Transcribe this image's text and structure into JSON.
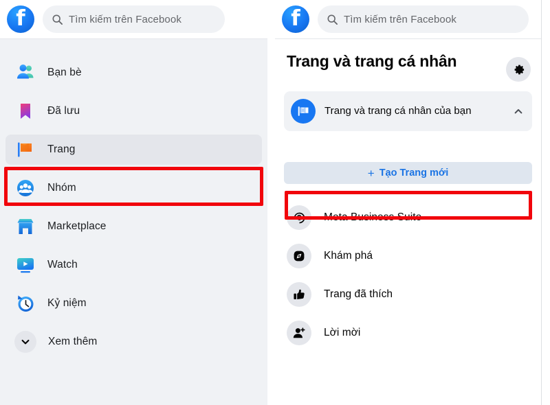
{
  "left": {
    "search": {
      "placeholder": "Tìm kiếm trên Facebook",
      "icon": "search-icon",
      "value": ""
    },
    "logo_icon": "facebook-logo-icon",
    "nav_items": [
      {
        "label": "Bạn bè",
        "icon": "friends-icon",
        "active": false
      },
      {
        "label": "Đã lưu",
        "icon": "bookmark-icon",
        "active": false
      },
      {
        "label": "Trang",
        "icon": "pages-flag-icon",
        "active": true
      },
      {
        "label": "Nhóm",
        "icon": "groups-icon",
        "active": false
      },
      {
        "label": "Marketplace",
        "icon": "marketplace-icon",
        "active": false
      },
      {
        "label": "Watch",
        "icon": "watch-icon",
        "active": false
      },
      {
        "label": "Kỷ niệm",
        "icon": "memories-icon",
        "active": false
      },
      {
        "label": "Xem thêm",
        "icon": "chevron-down-icon",
        "active": false
      }
    ]
  },
  "right": {
    "search": {
      "placeholder": "Tìm kiếm trên Facebook",
      "icon": "search-icon",
      "value": ""
    },
    "logo_icon": "facebook-logo-icon",
    "panel_title": "Trang và trang cá nhân",
    "settings_icon": "gear-icon",
    "your_pages": {
      "label": "Trang và trang cá nhân của bạn",
      "icon": "page-flag-icon",
      "expand_icon": "chevron-up-icon",
      "expanded": true
    },
    "create_button": {
      "label": "Tạo Trang mới",
      "plus": "+"
    },
    "menu_items": [
      {
        "label": "Meta Business Suite",
        "icon": "meta-icon"
      },
      {
        "label": "Khám phá",
        "icon": "compass-icon"
      },
      {
        "label": "Trang đã thích",
        "icon": "thumbs-up-icon"
      },
      {
        "label": "Lời mời",
        "icon": "person-add-icon"
      }
    ]
  },
  "annotations": {
    "highlight_color": "#f1050c",
    "boxes": [
      {
        "name": "trang-sidebar-highlight"
      },
      {
        "name": "tao-trang-moi-highlight"
      }
    ]
  },
  "colors": {
    "brand_blue": "#1877f2",
    "link_blue": "#1b74e4",
    "sidebar_bg": "#f0f2f5",
    "active_row": "#e4e6eb",
    "text_primary": "#050505",
    "text_secondary": "#65676b",
    "highlight_red": "#f1050c"
  }
}
